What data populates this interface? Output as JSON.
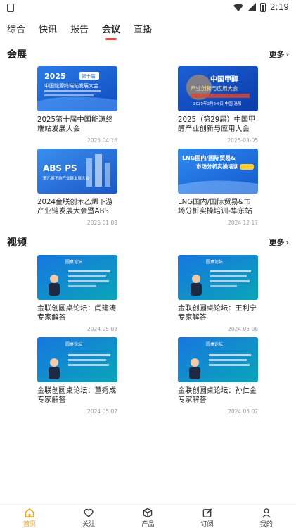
{
  "status": {
    "time": "2:19"
  },
  "tabs": [
    {
      "label": "综合",
      "active": false
    },
    {
      "label": "快讯",
      "active": false
    },
    {
      "label": "报告",
      "active": false
    },
    {
      "label": "会议",
      "active": true
    },
    {
      "label": "直播",
      "active": false
    }
  ],
  "sections": {
    "meetings": {
      "title": "会展",
      "more_label": "更多",
      "items": [
        {
          "title": "2025第十届中国能源终端站发展大会",
          "date": "2025 04 16",
          "thumb_lines": [
            "2025",
            "第十届",
            "中国能源终端站发展大会"
          ]
        },
        {
          "title": "2025（第29届）中国甲醇产业创新与应用大会",
          "date": "2025-03-05",
          "thumb_lines": [
            "中国甲醇",
            "产业创新与应用大会",
            "2025年3月5-6日 中国·洛阳"
          ]
        },
        {
          "title": "2024金联创苯乙烯下游产业链发展大会暨ABS PS...",
          "date": "2025 01 08",
          "thumb_lines": [
            "ABS PS",
            "苯乙烯下游产业链发展大会"
          ]
        },
        {
          "title": "LNG国内/国际贸易&市场分析实操培训-华东站",
          "date": "2024 12 17",
          "thumb_lines": [
            "LNG国内/国际贸易&",
            "市场分析实操培训"
          ]
        }
      ]
    },
    "videos": {
      "title": "视频",
      "more_label": "更多",
      "items": [
        {
          "title": "金联创圆桌论坛：闫建涛专家解答",
          "date": "2024 05 08",
          "thumb_lines": [
            "圆桌论坛"
          ]
        },
        {
          "title": "金联创圆桌论坛：王利宁专家解答",
          "date": "2024 05 08",
          "thumb_lines": [
            "圆桌论坛"
          ]
        },
        {
          "title": "金联创圆桌论坛：董秀成专家解答",
          "date": "2024 05 07",
          "thumb_lines": [
            "圆桌论坛"
          ]
        },
        {
          "title": "金联创圆桌论坛：孙仁金专家解答",
          "date": "2024 05 07",
          "thumb_lines": [
            "圆桌论坛"
          ]
        }
      ]
    }
  },
  "bottom_nav": [
    {
      "label": "首页",
      "icon": "home-icon",
      "active": true
    },
    {
      "label": "关注",
      "icon": "heart-icon",
      "active": false
    },
    {
      "label": "产品",
      "icon": "box-icon",
      "active": false
    },
    {
      "label": "订阅",
      "icon": "edit-icon",
      "active": false
    },
    {
      "label": "我的",
      "icon": "user-icon",
      "active": false
    }
  ],
  "colors": {
    "accent": "#e34a3a",
    "nav_active": "#f0a21b",
    "thumb_blue": "#1f6fe0"
  }
}
